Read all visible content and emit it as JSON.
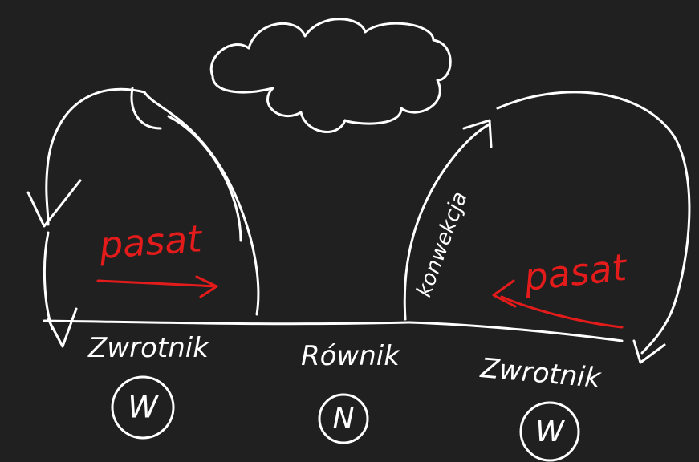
{
  "colors": {
    "background": "#202020",
    "ink": "#ffffff",
    "accent": "#e31b1b"
  },
  "labels": {
    "left_station": "Zwrotnik",
    "center_station": "Równik",
    "right_station": "Zwrotnik",
    "left_wind": "pasat",
    "right_wind": "pasat",
    "convection": "konwekcja"
  },
  "circles": {
    "left": "W",
    "center": "N",
    "right": "W"
  },
  "icons": {
    "cloud": "cloud-icon",
    "arrow": "arrow-icon"
  }
}
